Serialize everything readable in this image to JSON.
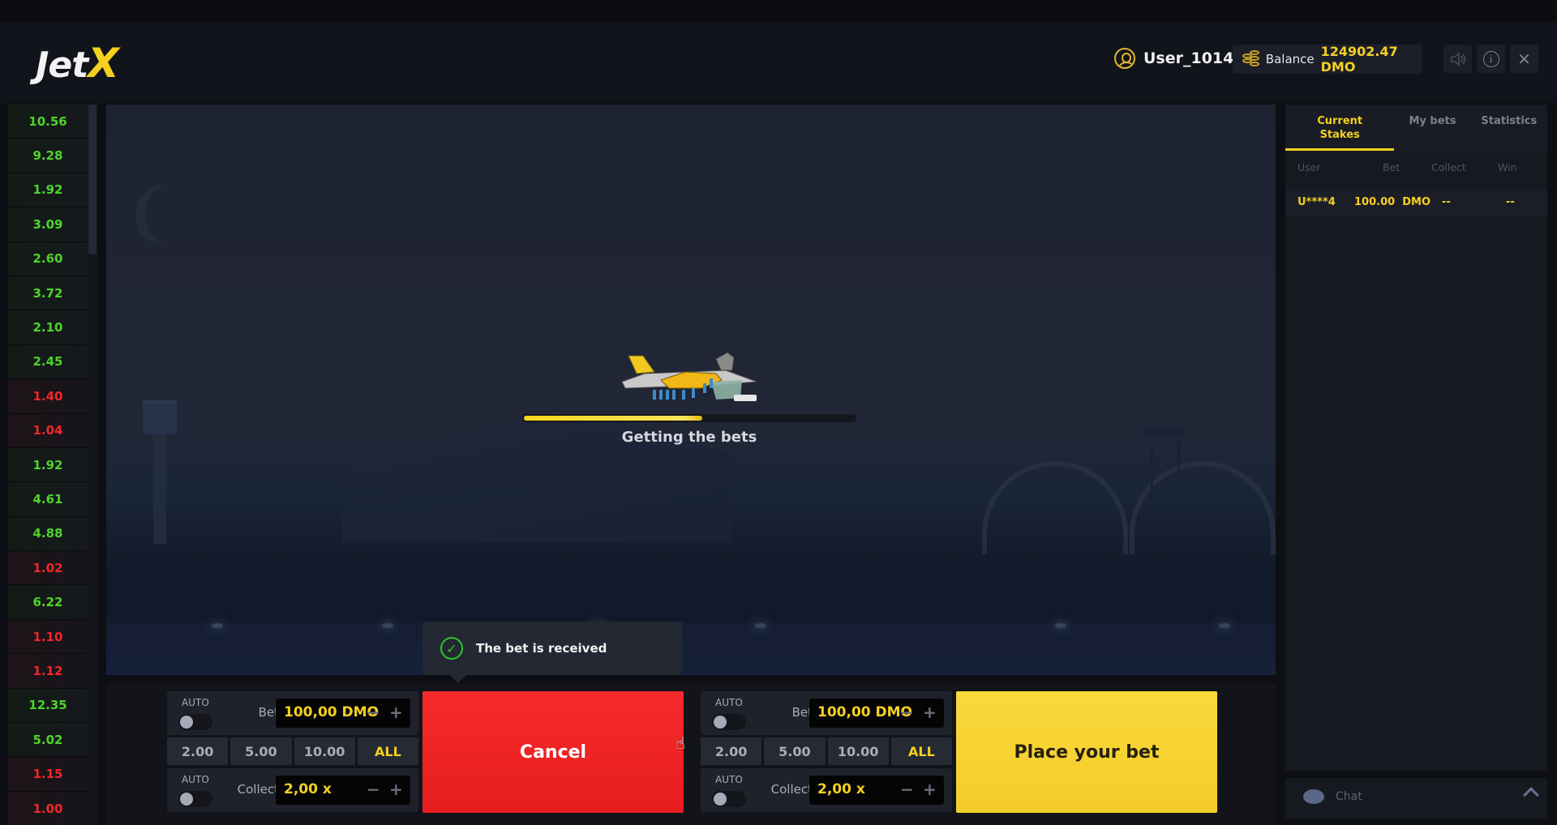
{
  "header": {
    "logo_main": "Jet",
    "logo_accent": "X",
    "username": "User_1014",
    "balance_label": "Balance",
    "balance_value": "124902.47 DMO",
    "buttons": {
      "sound": "sound-icon",
      "info": "i",
      "close": "✕"
    }
  },
  "multipliers": [
    {
      "value": "10.56",
      "color": "green"
    },
    {
      "value": "9.28",
      "color": "green"
    },
    {
      "value": "1.92",
      "color": "green"
    },
    {
      "value": "3.09",
      "color": "green"
    },
    {
      "value": "2.60",
      "color": "green"
    },
    {
      "value": "3.72",
      "color": "green"
    },
    {
      "value": "2.10",
      "color": "green"
    },
    {
      "value": "2.45",
      "color": "green"
    },
    {
      "value": "1.40",
      "color": "red"
    },
    {
      "value": "1.04",
      "color": "red"
    },
    {
      "value": "1.92",
      "color": "green"
    },
    {
      "value": "4.61",
      "color": "green"
    },
    {
      "value": "4.88",
      "color": "green"
    },
    {
      "value": "1.02",
      "color": "red"
    },
    {
      "value": "6.22",
      "color": "green"
    },
    {
      "value": "1.10",
      "color": "red"
    },
    {
      "value": "1.12",
      "color": "red"
    },
    {
      "value": "12.35",
      "color": "green"
    },
    {
      "value": "5.02",
      "color": "green"
    },
    {
      "value": "1.15",
      "color": "red"
    },
    {
      "value": "1.00",
      "color": "red"
    }
  ],
  "game": {
    "status_text": "Getting the bets",
    "progress_fraction": 0.54,
    "toast": "The bet is received"
  },
  "bet_panels": [
    {
      "auto_label": "AUTO",
      "bet_label": "Bet",
      "bet_value": "100,00 DMO",
      "chips": [
        "2.00",
        "5.00",
        "10.00",
        "ALL"
      ],
      "collect_auto_label": "AUTO",
      "collect_label": "Collect",
      "collect_value": "2,00 x",
      "minus": "−",
      "plus": "+",
      "action_label": "Cancel"
    },
    {
      "auto_label": "AUTO",
      "bet_label": "Bet",
      "bet_value": "100,00 DMO",
      "chips": [
        "2.00",
        "5.00",
        "10.00",
        "ALL"
      ],
      "collect_auto_label": "AUTO",
      "collect_label": "Collect",
      "collect_value": "2,00 x",
      "minus": "−",
      "plus": "+",
      "action_label": "Place your bet"
    }
  ],
  "panel": {
    "tabs": [
      {
        "label": "Current Stakes",
        "active": true
      },
      {
        "label": "My bets",
        "active": false
      },
      {
        "label": "Statistics",
        "active": false
      }
    ],
    "columns": [
      "User",
      "Bet",
      "Collect",
      "Win"
    ],
    "rows": [
      {
        "user": "U****4",
        "bet": "100.00  DMO",
        "collect": "--",
        "win": "--"
      }
    ],
    "chat_label": "Chat"
  },
  "colors": {
    "accent": "#f5d020",
    "win_green": "#4ed42b",
    "loss_red": "#f2272a",
    "cancel_red": "#f62a2a",
    "place_yellow": "#fad93b"
  }
}
